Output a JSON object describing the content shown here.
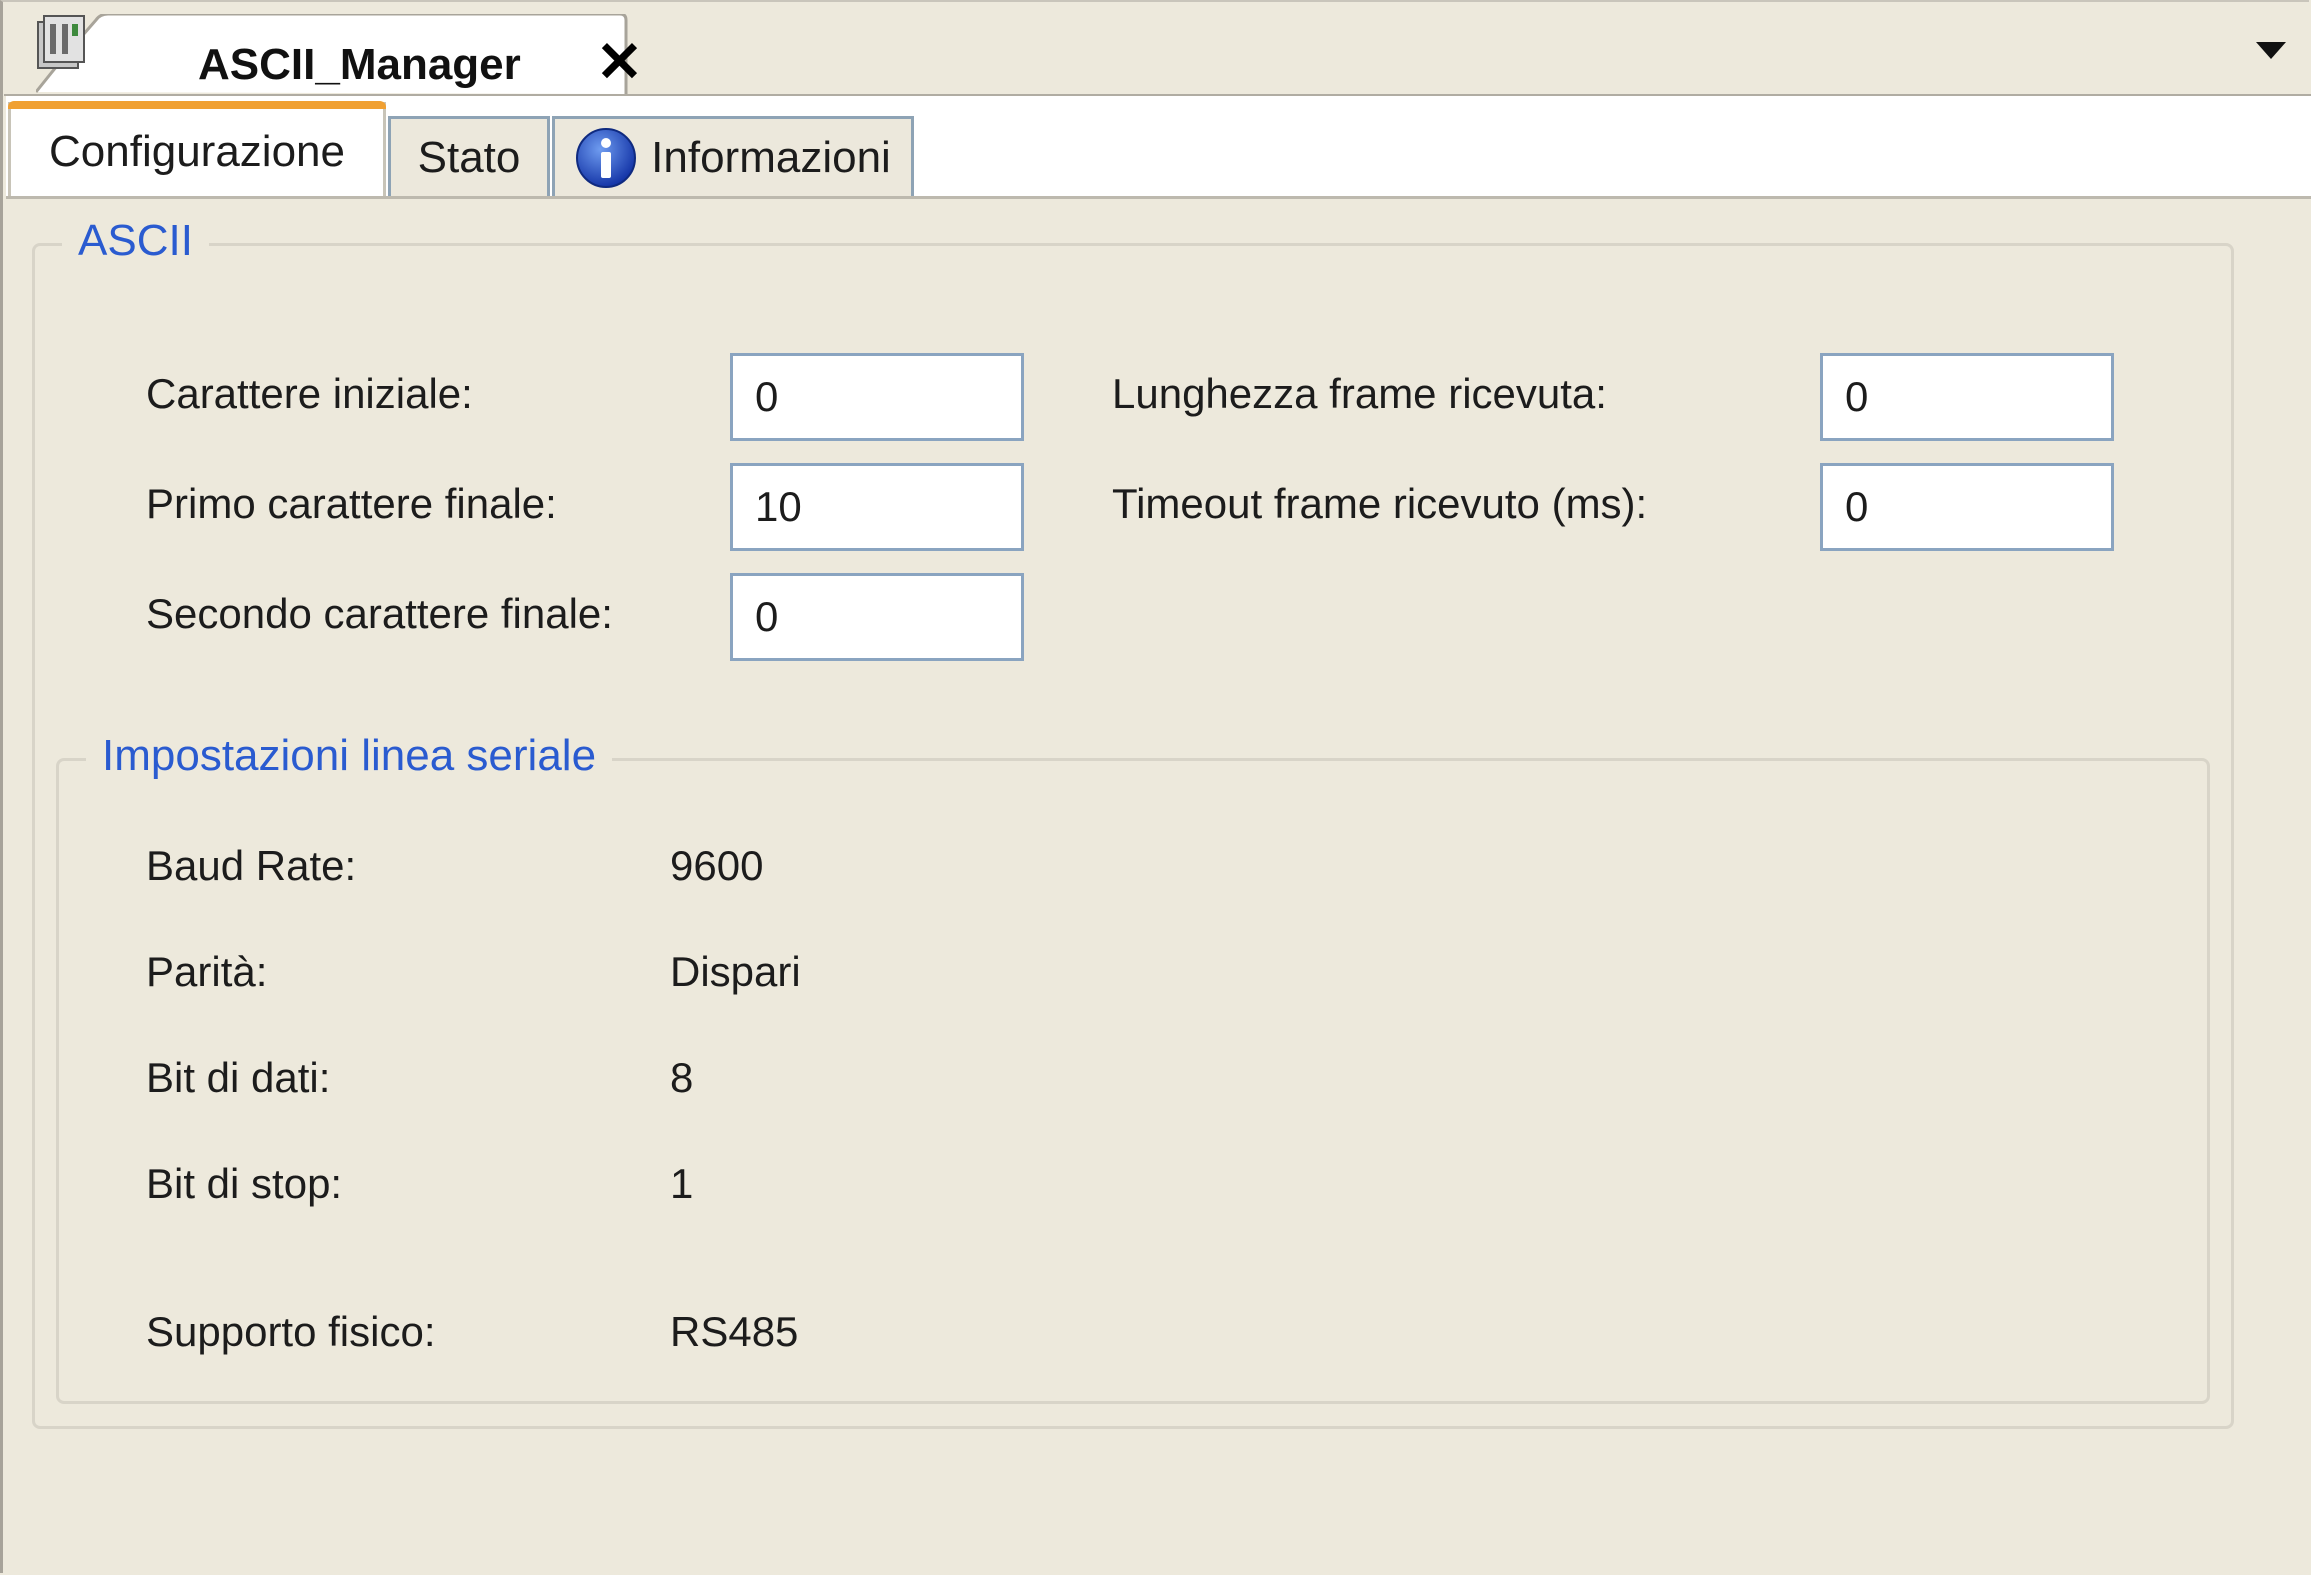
{
  "editor": {
    "title": "ASCII_Manager",
    "icon": "device-icon",
    "close_symbol": "✕",
    "menu_icon": "chevron-down-icon"
  },
  "tabs": [
    {
      "label": "Configurazione",
      "active": true
    },
    {
      "label": "Stato",
      "active": false
    },
    {
      "label": "Informazioni",
      "active": false,
      "icon": "info-icon"
    }
  ],
  "ascii": {
    "title": "ASCII",
    "start_char_label": "Carattere iniziale:",
    "start_char_value": "0",
    "first_end_char_label": "Primo carattere finale:",
    "first_end_char_value": "10",
    "second_end_char_label": "Secondo carattere finale:",
    "second_end_char_value": "0",
    "frame_length_label": "Lunghezza frame ricevuta:",
    "frame_length_value": "0",
    "frame_timeout_label": "Timeout frame ricevuto (ms):",
    "frame_timeout_value": "0"
  },
  "serial": {
    "title": "Impostazioni linea seriale",
    "rows": [
      {
        "label": "Baud Rate:",
        "value": "9600"
      },
      {
        "label": "Parità:",
        "value": "Dispari"
      },
      {
        "label": "Bit di dati:",
        "value": "8"
      },
      {
        "label": "Bit di stop:",
        "value": "1"
      },
      {
        "label": "Supporto fisico:",
        "value": "RS485"
      }
    ]
  },
  "colors": {
    "background": "#ede9dc",
    "group_title": "#2a5bd0",
    "active_tab_accent": "#f0a032",
    "field_border": "#8aa4c0"
  }
}
